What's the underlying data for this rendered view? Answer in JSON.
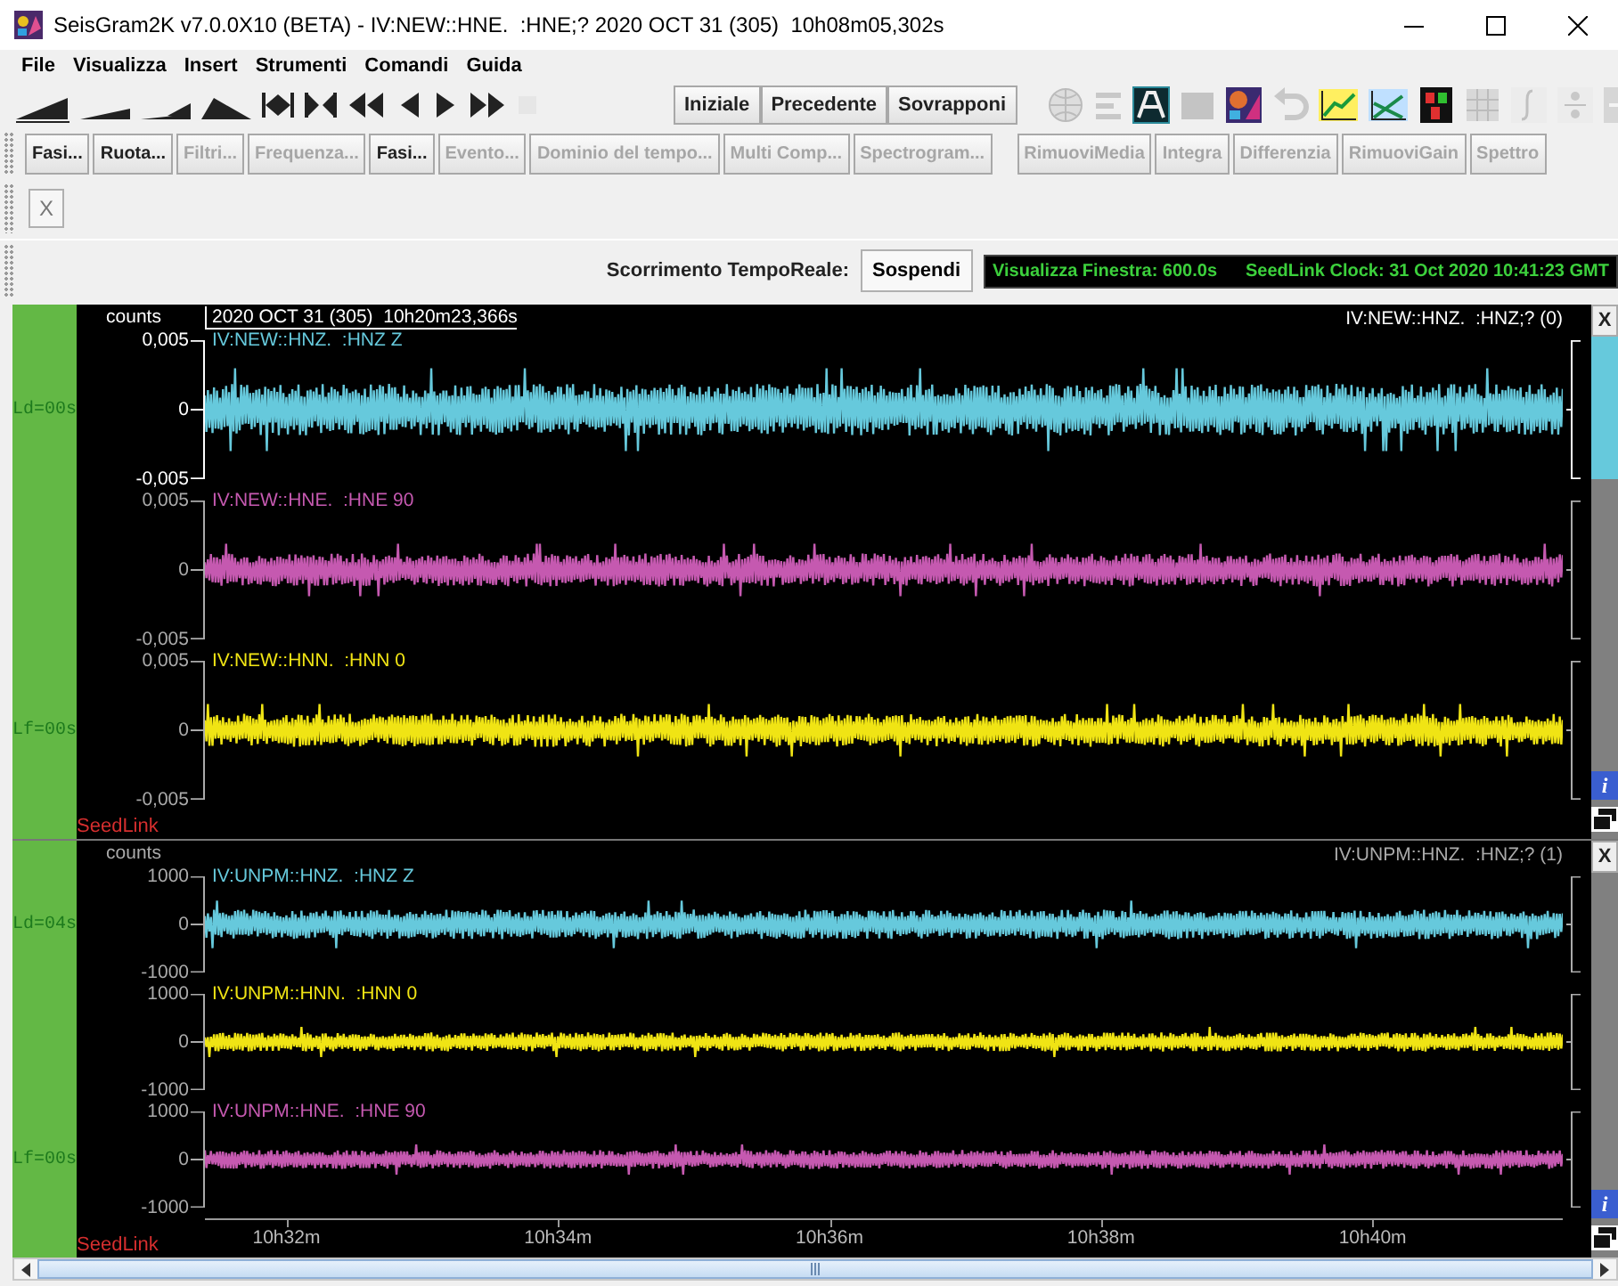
{
  "window": {
    "title": "SeisGram2K v7.0.0X10 (BETA) - IV:NEW::HNE.  :HNE;? 2020 OCT 31 (305)  10h08m05,302s"
  },
  "menu": [
    "File",
    "Visualizza",
    "Insert",
    "Strumenti",
    "Comandi",
    "Guida"
  ],
  "toolbar": {
    "buttons": [
      "Iniziale",
      "Precedente",
      "Sovrapponi"
    ]
  },
  "command_bar": {
    "buttons": [
      {
        "label": "Fasi...",
        "disabled": false
      },
      {
        "label": "Ruota...",
        "disabled": false
      },
      {
        "label": "Filtri...",
        "disabled": true
      },
      {
        "label": "Frequenza...",
        "disabled": true
      },
      {
        "label": "Fasi...",
        "disabled": false
      },
      {
        "label": "Evento...",
        "disabled": true
      },
      {
        "label": "Dominio del tempo...",
        "disabled": true
      },
      {
        "label": "Multi Comp...",
        "disabled": true
      },
      {
        "label": "Spectrogram...",
        "disabled": true
      },
      {
        "label": "RimuoviMedia",
        "disabled": true
      },
      {
        "label": "Integra",
        "disabled": true
      },
      {
        "label": "Differenzia",
        "disabled": true
      },
      {
        "label": "RimuoviGain",
        "disabled": true
      },
      {
        "label": "Spettro",
        "disabled": true
      }
    ]
  },
  "filter_bar": {
    "button": "X"
  },
  "realtime_bar": {
    "label": "Scorrimento TempoReale:",
    "button": "Sospendi",
    "window_info": "Visualizza Finestra: 600.0s",
    "clock": "SeedLink Clock: 31 Oct 2020 10:41:23 GMT"
  },
  "panels": [
    {
      "selected": true,
      "units": "counts",
      "start_time": "2020 OCT 31 (305)  10h20m23,366s",
      "station": "IV:NEW::HNZ.  :HNZ;? (0)",
      "source": "SeedLink",
      "close_button": "X",
      "info_button": "i",
      "traces": [
        {
          "name": "IV:NEW::HNZ.  :HNZ Z",
          "color": "#66c9dc",
          "selected": true,
          "side_label": "Ld=00s",
          "ticks": [
            "0,005",
            "0",
            "-0,005"
          ]
        },
        {
          "name": "IV:NEW::HNE.  :HNE 90",
          "color": "#c559b0",
          "selected": false,
          "ticks": [
            "0,005",
            "0",
            "-0,005"
          ]
        },
        {
          "name": "IV:NEW::HNN.  :HNN 0",
          "color": "#f0e414",
          "selected": false,
          "side_label": "Lf=00s",
          "ticks": [
            "0,005",
            "0",
            "-0,005"
          ]
        }
      ]
    },
    {
      "selected": false,
      "units": "counts",
      "station": "IV:UNPM::HNZ.  :HNZ;? (1)",
      "source": "SeedLink",
      "close_button": "X",
      "info_button": "i",
      "traces": [
        {
          "name": "IV:UNPM::HNZ.  :HNZ Z",
          "color": "#66c9dc",
          "selected": false,
          "side_label": "Ld=04s",
          "ticks": [
            "1000",
            "0",
            "-1000"
          ]
        },
        {
          "name": "IV:UNPM::HNN.  :HNN 0",
          "color": "#f0e414",
          "selected": false,
          "ticks": [
            "1000",
            "0",
            "-1000"
          ]
        },
        {
          "name": "IV:UNPM::HNE.  :HNE 90",
          "color": "#c559b0",
          "selected": false,
          "side_label": "Lf=00s",
          "ticks": [
            "1000",
            "0",
            "-1000"
          ]
        }
      ]
    }
  ],
  "time_axis": [
    "10h32m",
    "10h34m",
    "10h36m",
    "10h38m",
    "10h40m"
  ]
}
